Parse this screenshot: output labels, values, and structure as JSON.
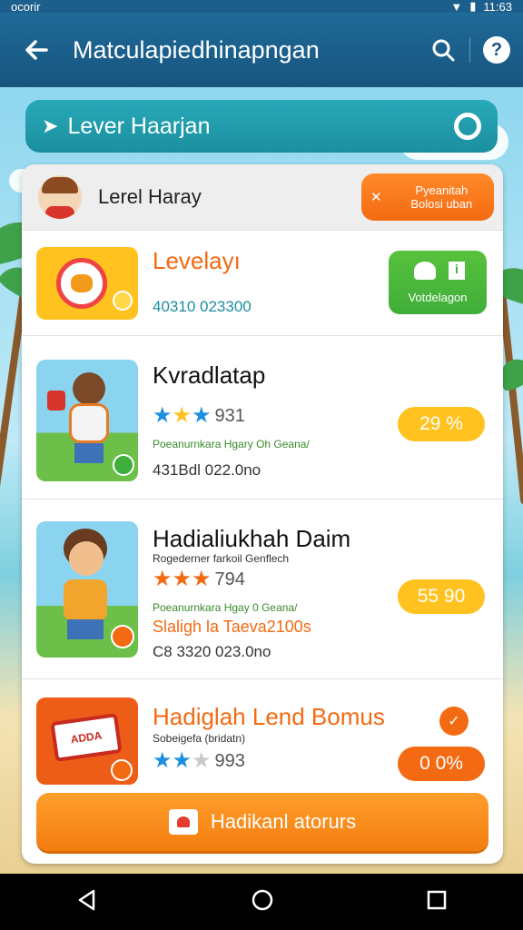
{
  "status_bar": {
    "left": "ocorir",
    "time": "11:63"
  },
  "app_bar": {
    "title": "Matculapiedhinapngan",
    "back_icon": "back-arrow-icon",
    "search_icon": "search-icon",
    "help_icon": "help-icon"
  },
  "search": {
    "label": "Lever Haarjan",
    "lead_icon": "bird-icon",
    "trail_icon": "ring-icon"
  },
  "user": {
    "name": "Lerel Haray",
    "button_line1": "Pyeanitah",
    "button_line2": "Bolosi uban"
  },
  "items": [
    {
      "name": "Levelayı",
      "code": "40310 023300",
      "action_label": "Votdelagon",
      "accent": "#f46a12"
    },
    {
      "name": "Kvradlatap",
      "rating": "931",
      "stars": 3,
      "sub": "Poeanurnkara Hgary Oh Geana/",
      "code": "431Bdl 022.0no",
      "badge": "29 %"
    },
    {
      "name": "Hadialiukhah Daim",
      "small": "Rogederner farkoil Genflech",
      "rating": "794",
      "stars": 3,
      "sub": "Poeanurnkara Hgay 0 Geana/",
      "highlight": "Slaligh la Taeva2100s",
      "code": "C8 3320 023.0no",
      "badge": "55 90"
    },
    {
      "name": "Hadiglah Lend Bomus",
      "small": "Sobeigefa (bridatn)",
      "rating": "993",
      "stars": 2,
      "badge": "0 0%",
      "thumb_label": "ADDA"
    }
  ],
  "cta": {
    "label": "Hadikanl atorurs"
  },
  "colors": {
    "primary": "#17557f",
    "accent": "#f46a12",
    "teal": "#1b8f9f",
    "gold": "#ffc21f",
    "green": "#3fae3a"
  }
}
